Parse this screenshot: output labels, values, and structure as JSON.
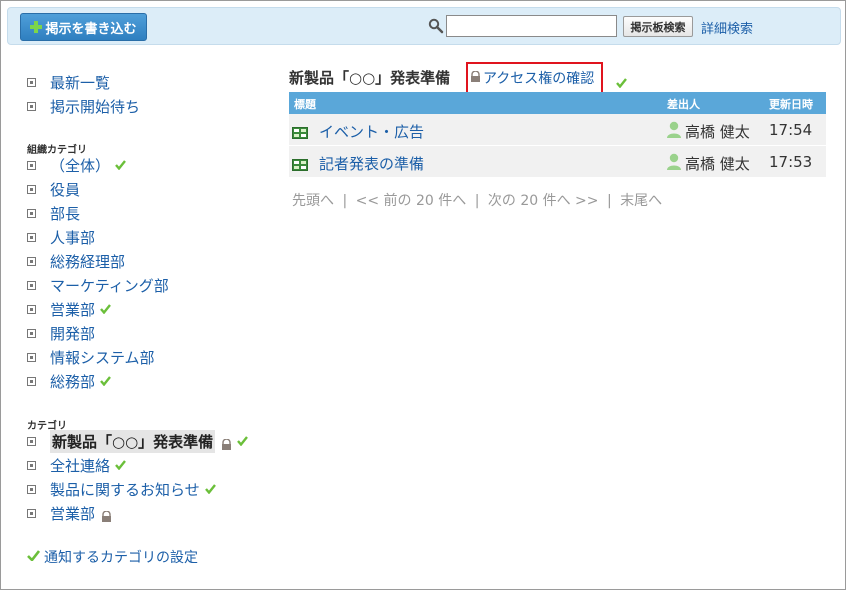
{
  "toolbar": {
    "write_button": "掲示を書き込む",
    "search_placeholder": "",
    "search_button": "掲示板検索",
    "advanced_search": "詳細検索"
  },
  "sidebar": {
    "top_items": [
      "最新一覧",
      "掲示開始待ち"
    ],
    "org_label": "組織カテゴリ",
    "org_items": [
      {
        "label": "（全体）",
        "checked": true
      },
      {
        "label": "役員",
        "checked": false
      },
      {
        "label": "部長",
        "checked": false
      },
      {
        "label": "人事部",
        "checked": false
      },
      {
        "label": "総務経理部",
        "checked": false
      },
      {
        "label": "マーケティング部",
        "checked": false
      },
      {
        "label": "営業部",
        "checked": true
      },
      {
        "label": "開発部",
        "checked": false
      },
      {
        "label": "情報システム部",
        "checked": false
      },
      {
        "label": "総務部",
        "checked": true
      }
    ],
    "cat_label": "カテゴリ",
    "cat_items": [
      {
        "label": "新製品「○○」発表準備",
        "current": true,
        "locked": true,
        "checked": true
      },
      {
        "label": "全社連絡",
        "current": false,
        "locked": false,
        "checked": true
      },
      {
        "label": "製品に関するお知らせ",
        "current": false,
        "locked": false,
        "checked": true
      },
      {
        "label": "営業部",
        "current": false,
        "locked": true,
        "checked": false
      }
    ],
    "notify_link": "通知するカテゴリの設定"
  },
  "main": {
    "title": "新製品「○○」発表準備",
    "access_link": "アクセス権の確認",
    "columns": {
      "title": "標題",
      "sender": "差出人",
      "updated": "更新日時"
    },
    "rows": [
      {
        "title": "イベント・広告",
        "sender": "高橋 健太",
        "time": "17:54"
      },
      {
        "title": "記者発表の準備",
        "sender": "高橋 健太",
        "time": "17:53"
      }
    ],
    "pager": {
      "first": "先頭へ",
      "prev": "<< 前の 20 件へ",
      "next": "次の 20 件へ >>",
      "last": "末尾へ",
      "sep": "|"
    }
  },
  "colors": {
    "accent": "#2f7fc0",
    "link": "#1c5fa8",
    "header_bg": "#5aa7d9",
    "check": "#6bbf3a",
    "highlight_border": "#e0141e"
  }
}
